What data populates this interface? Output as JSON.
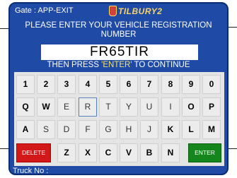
{
  "header": {
    "gate_label": "Gate : APP-EXIT",
    "logo_text": "TILBURY2"
  },
  "prompt": {
    "line1": "PLEASE ENTER YOUR VEHICLE REGISTRATION",
    "line2": "NUMBER",
    "registration_value": "FR65TIR",
    "then_prefix": "THEN PRESS ",
    "then_enter": "'ENTER'",
    "then_suffix": " TO CONTINUE"
  },
  "keyboard": {
    "row1": [
      "1",
      "2",
      "3",
      "4",
      "5",
      "6",
      "7",
      "8",
      "9",
      "0"
    ],
    "row2": [
      "Q",
      "W",
      "E",
      "R",
      "T",
      "Y",
      "U",
      "I",
      "O",
      "P"
    ],
    "row3": [
      "A",
      "S",
      "D",
      "F",
      "G",
      "H",
      "J",
      "K",
      "L",
      "M"
    ],
    "row4": [
      "Z",
      "X",
      "C",
      "V",
      "B",
      "N"
    ],
    "delete_label": "DELETE",
    "enter_label": "ENTER"
  },
  "status": {
    "truck_label": "Truck No :"
  },
  "colors": {
    "panel_blue": "#1f4aa6",
    "delete_red": "#d21818",
    "enter_green": "#15861b",
    "prompt_highlight": "#f3e070"
  }
}
